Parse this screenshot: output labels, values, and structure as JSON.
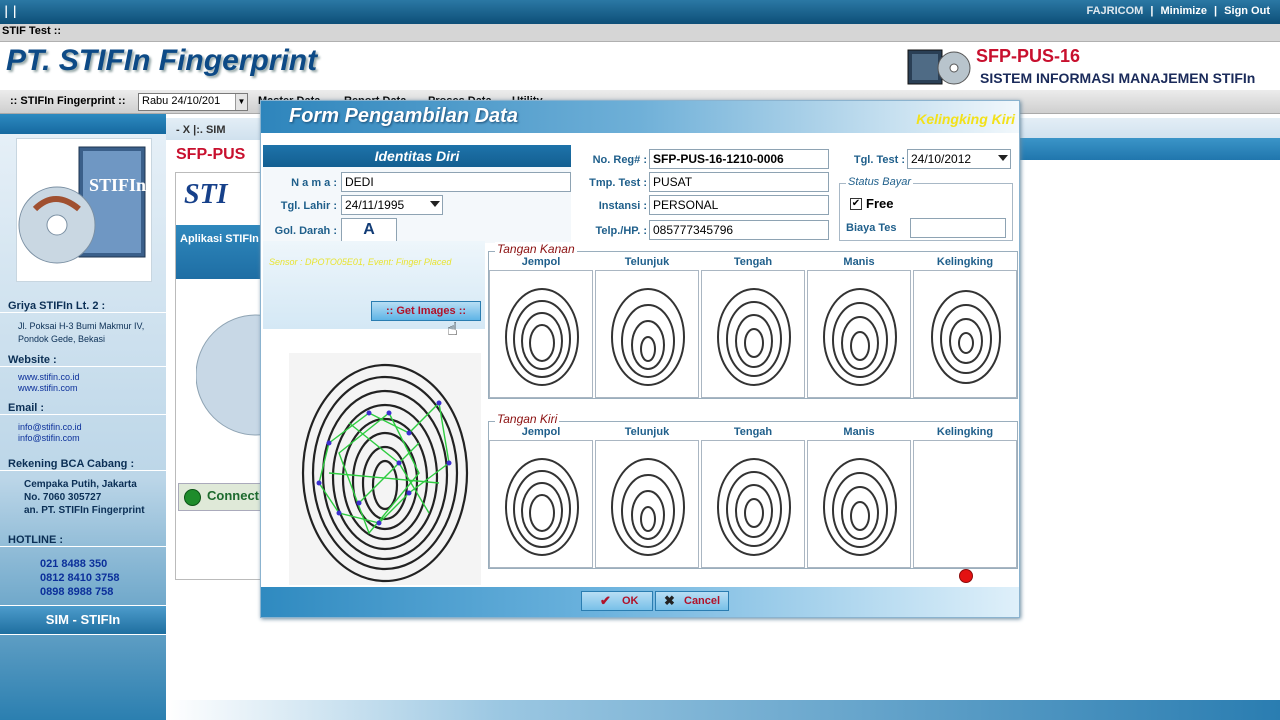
{
  "window": {
    "pause": "| |",
    "user": "FAJRICOM",
    "minimize": "Minimize",
    "signout": "Sign Out",
    "sep": "|"
  },
  "tab": {
    "label": "STIF Test ::"
  },
  "header": {
    "brand": "PT. STIFIn Fingerprint",
    "code": "SFP-PUS-16",
    "system": "SISTEM INFORMASI MANAJEMEN STIFIn"
  },
  "menubar": {
    "label": ":: STIFIn Fingerprint ::",
    "date": "Rabu 24/10/201",
    "items": [
      "Master Data",
      "Report Data",
      "Proses Data",
      "Utility"
    ]
  },
  "sidebar": {
    "address_title": "Griya STIFIn Lt. 2 :",
    "address_lines": [
      "Jl. Poksai H-3 Bumi Makmur IV,",
      "Pondok Gede, Bekasi"
    ],
    "website_title": "Website :",
    "websites": [
      "www.stifin.co.id",
      "www.stifin.com"
    ],
    "email_title": "Email :",
    "emails": [
      "info@stifin.co.id",
      "info@stifin.com"
    ],
    "bank_title": "Rekening BCA Cabang :",
    "bank_lines": [
      "Cempaka Putih, Jakarta",
      "No.  7060 305727",
      "an.  PT. STIFIn Fingerprint"
    ],
    "hotline_title": "HOTLINE  :",
    "hotlines": [
      "021 8488  350",
      "0812 8410 3758",
      "0898 8988 758"
    ],
    "footer": "SIM - STIFIn"
  },
  "background_page": {
    "toolbar": "-   X  |:.  SIM",
    "code": "SFP-PUS",
    "logo_text": "STI",
    "aplikasi": "Aplikasi STIFIn",
    "connection": "Connecti"
  },
  "modal": {
    "title": "Form Pengambilan Data",
    "corner_label": "Kelingking Kiri",
    "identitas_title": "Identitas Diri",
    "nama_label": "N a m a  :",
    "nama": "DEDI",
    "tgl_lahir_label": "Tgl. Lahir  :",
    "tgl_lahir": "24/11/1995",
    "gol_darah_label": "Gol. Darah  :",
    "gol_darah": "A",
    "noreg_label": "No. Reg#  :",
    "noreg": "SFP-PUS-16-1210-0006",
    "tmp_test_label": "Tmp. Test  :",
    "tmp_test": "PUSAT",
    "instansi_label": "Instansi  :",
    "instansi": "PERSONAL",
    "telp_label": "Telp./HP.  :",
    "telp": "085777345796",
    "tgl_test_label": "Tgl. Test  :",
    "tgl_test": "24/10/2012",
    "status_bayar_label": "Status Bayar",
    "free_label": "Free",
    "free_checked": "✔",
    "biaya_label": "Biaya Tes",
    "biaya": "",
    "sensor_text": "Sensor : DPOTO05E01, Event: Finger Placed",
    "get_images": ":: Get  Images ::",
    "right_hand_label": "Tangan Kanan",
    "left_hand_label": "Tangan Kiri",
    "fingers": [
      "Jempol",
      "Telunjuk",
      "Tengah",
      "Manis",
      "Kelingking"
    ],
    "ok_label": "OK",
    "cancel_label": "Cancel"
  },
  "colors": {
    "title_blue": "#2e85bc",
    "brand_navy": "#0d4a86",
    "accent_red": "#c8102e",
    "label_blue": "#1f5f8b"
  }
}
